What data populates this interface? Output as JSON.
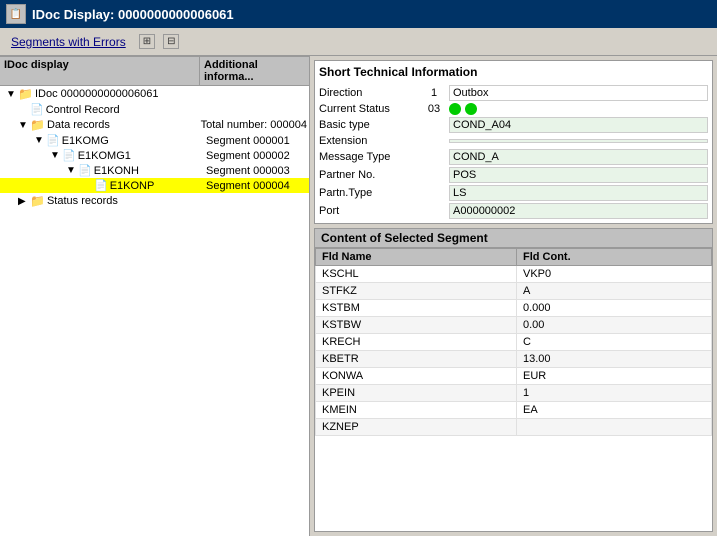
{
  "titleBar": {
    "icon": "🗂",
    "title": "IDoc Display: 0000000000006061"
  },
  "toolbar": {
    "segmentsBtn": "Segments with Errors",
    "icon1": "⊞",
    "icon2": "⊟"
  },
  "leftPanel": {
    "col1": "IDoc display",
    "col2": "Additional informa...",
    "tree": [
      {
        "level": 0,
        "toggle": "▼",
        "icon": "folder",
        "label": "IDoc 0000000000006061",
        "segment": "",
        "selected": false
      },
      {
        "level": 1,
        "toggle": "",
        "icon": "doc",
        "label": "Control Record",
        "segment": "",
        "selected": false
      },
      {
        "level": 1,
        "toggle": "▼",
        "icon": "folder",
        "label": "Data records",
        "segment": "Total number: 000004",
        "selected": false
      },
      {
        "level": 2,
        "toggle": "▼",
        "icon": "doc",
        "label": "E1KOMG",
        "segment": "Segment 000001",
        "selected": false
      },
      {
        "level": 3,
        "toggle": "▼",
        "icon": "doc",
        "label": "E1KOMG1",
        "segment": "Segment 000002",
        "selected": false
      },
      {
        "level": 4,
        "toggle": "▼",
        "icon": "doc",
        "label": "E1KONH",
        "segment": "Segment 000003",
        "selected": false
      },
      {
        "level": 5,
        "toggle": "",
        "icon": "doc",
        "label": "E1KONP",
        "segment": "Segment 000004",
        "selected": true
      },
      {
        "level": 1,
        "toggle": "▶",
        "icon": "folder",
        "label": "Status records",
        "segment": "",
        "selected": false
      }
    ]
  },
  "shortTechnical": {
    "title": "Short Technical Information",
    "fields": {
      "direction_label": "Direction",
      "direction_num": "1",
      "direction_val": "Outbox",
      "status_label": "Current Status",
      "status_num": "03",
      "status_indicator": "green",
      "basictype_label": "Basic type",
      "basictype_val": "COND_A04",
      "extension_label": "Extension",
      "extension_val": "",
      "msgtype_label": "Message Type",
      "msgtype_val": "COND_A",
      "partnerno_label": "Partner No.",
      "partnerno_val": "POS",
      "partntype_label": "Partn.Type",
      "partntype_val": "LS",
      "port_label": "Port",
      "port_val": "A000000002"
    }
  },
  "selectedSegment": {
    "title": "Content of Selected Segment",
    "headers": [
      "Fld Name",
      "Fld Cont."
    ],
    "rows": [
      {
        "field": "KSCHL",
        "value": "VKP0"
      },
      {
        "field": "STFKZ",
        "value": "A"
      },
      {
        "field": "KSTBM",
        "value": "0.000"
      },
      {
        "field": "KSTBW",
        "value": "0.00"
      },
      {
        "field": "KRECH",
        "value": "C"
      },
      {
        "field": "KBETR",
        "value": "13.00"
      },
      {
        "field": "KONWA",
        "value": "EUR"
      },
      {
        "field": "KPEIN",
        "value": "1"
      },
      {
        "field": "KMEIN",
        "value": "EA"
      },
      {
        "field": "KZNEP",
        "value": ""
      }
    ]
  }
}
